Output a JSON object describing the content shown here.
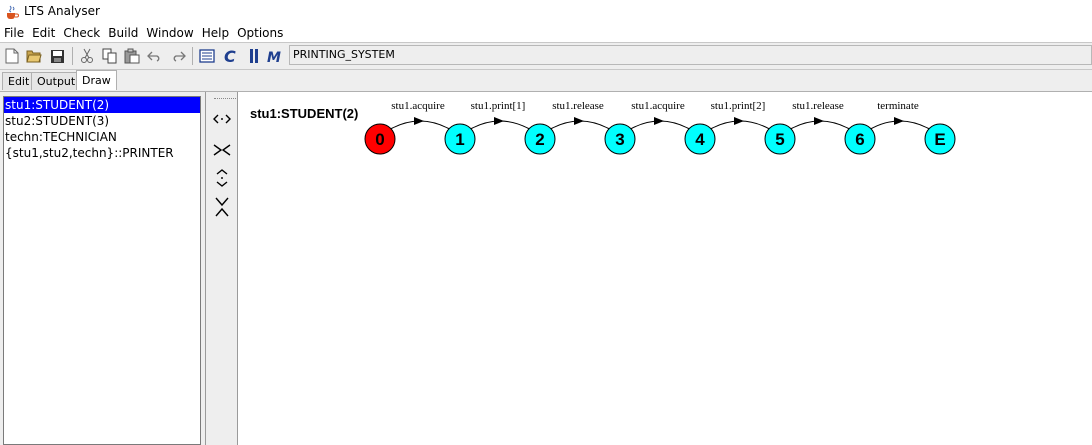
{
  "window": {
    "title": "LTS Analyser"
  },
  "menu": [
    "File",
    "Edit",
    "Check",
    "Build",
    "Window",
    "Help",
    "Options"
  ],
  "toolbar": {
    "buttons": [
      "new-file",
      "open-file",
      "save",
      "cut",
      "copy",
      "paste",
      "undo",
      "redo",
      "parse",
      "compile",
      "compose",
      "minimise"
    ],
    "target": "PRINTING_SYSTEM"
  },
  "tabs": [
    {
      "label": "Edit",
      "active": false
    },
    {
      "label": "Output",
      "active": false
    },
    {
      "label": "Draw",
      "active": true
    }
  ],
  "process_list": {
    "items": [
      {
        "label": "stu1:STUDENT(2)",
        "selected": true
      },
      {
        "label": "stu2:STUDENT(3)",
        "selected": false
      },
      {
        "label": "techn:TECHNICIAN",
        "selected": false
      },
      {
        "label": "{stu1,stu2,techn}::PRINTER",
        "selected": false
      }
    ]
  },
  "side_tools": [
    "expand-horizontal",
    "shrink-horizontal",
    "expand-vertical",
    "shrink-vertical"
  ],
  "diagram": {
    "title": "stu1:STUDENT(2)",
    "states": [
      {
        "label": "0",
        "color": "#ff0000"
      },
      {
        "label": "1",
        "color": "#00ffff"
      },
      {
        "label": "2",
        "color": "#00ffff"
      },
      {
        "label": "3",
        "color": "#00ffff"
      },
      {
        "label": "4",
        "color": "#00ffff"
      },
      {
        "label": "5",
        "color": "#00ffff"
      },
      {
        "label": "6",
        "color": "#00ffff"
      },
      {
        "label": "E",
        "color": "#00ffff"
      }
    ],
    "transitions": [
      "stu1.acquire",
      "stu1.print[1]",
      "stu1.release",
      "stu1.acquire",
      "stu1.print[2]",
      "stu1.release",
      "terminate"
    ]
  },
  "colors": {
    "selection": "#0000ff",
    "initial_state": "#ff0000",
    "state": "#00ffff"
  }
}
